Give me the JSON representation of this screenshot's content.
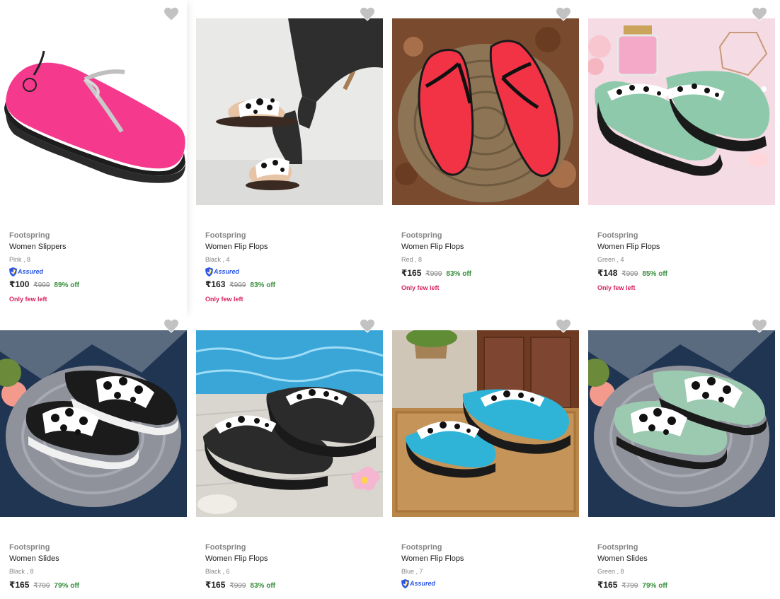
{
  "colors": {
    "price": "#212121",
    "mrp": "#878787",
    "discount": "#388e3c",
    "stock": "#d61f5f",
    "assured": "#2a55e5",
    "heart": "#c2c2c2"
  },
  "icons": {
    "wishlist": "heart-icon",
    "assured": "assured-shield-icon"
  },
  "products": [
    {
      "brand": "Footspring",
      "title": "Women Slippers",
      "variant": "Pink , 8",
      "assured": true,
      "assured_label": "Assured",
      "price": "₹100",
      "mrp": "₹999",
      "discount": "89% off",
      "stock": "Only few left",
      "image": "pink-wedge-slipper"
    },
    {
      "brand": "Footspring",
      "title": "Women Flip Flops",
      "variant": "Black , 4",
      "assured": true,
      "assured_label": "Assured",
      "price": "₹163",
      "mrp": "₹999",
      "discount": "83% off",
      "stock": "Only few left",
      "image": "black-slide-on-feet"
    },
    {
      "brand": "Footspring",
      "title": "Women Flip Flops",
      "variant": "Red , 8",
      "assured": false,
      "price": "₹165",
      "mrp": "₹999",
      "discount": "83% off",
      "stock": "Only few left",
      "image": "red-flip-flops-on-mat"
    },
    {
      "brand": "Footspring",
      "title": "Women Flip Flops",
      "variant": "Green , 4",
      "assured": false,
      "price": "₹148",
      "mrp": "₹999",
      "discount": "85% off",
      "stock": "Only few left",
      "image": "green-print-flip-flops"
    },
    {
      "brand": "Footspring",
      "title": "Women Slides",
      "variant": "Black , 8",
      "assured": false,
      "price": "₹165",
      "mrp": "₹799",
      "discount": "79% off",
      "stock": "",
      "image": "black-print-slides"
    },
    {
      "brand": "Footspring",
      "title": "Women Flip Flops",
      "variant": "Black , 6",
      "assured": false,
      "price": "₹165",
      "mrp": "₹999",
      "discount": "83% off",
      "stock": "",
      "image": "black-print-flip-flops-pool"
    },
    {
      "brand": "Footspring",
      "title": "Women Flip Flops",
      "variant": "Blue , 7",
      "assured": true,
      "assured_label": "Assured",
      "price": "",
      "mrp": "",
      "discount": "",
      "stock": "",
      "image": "blue-print-flip-flops-doormat"
    },
    {
      "brand": "Footspring",
      "title": "Women Slides",
      "variant": "Green , 8",
      "assured": false,
      "price": "₹165",
      "mrp": "₹799",
      "discount": "79% off",
      "stock": "",
      "image": "green-print-slides"
    }
  ]
}
